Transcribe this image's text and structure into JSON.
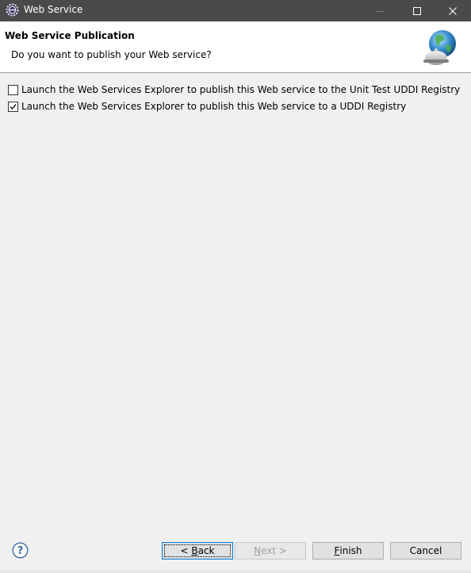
{
  "window": {
    "title": "Web Service",
    "icons": {
      "app": "eclipse-gear-icon",
      "minimize": "minimize-icon",
      "maximize": "maximize-icon",
      "close": "close-icon"
    }
  },
  "banner": {
    "title": "Web Service Publication",
    "description": "Do you want to publish your Web service?",
    "art": "globe-bell-icon"
  },
  "options": [
    {
      "label": "Launch the Web Services Explorer to publish this Web service to the Unit Test UDDI Registry",
      "checked": false
    },
    {
      "label": "Launch the Web Services Explorer to publish this Web service to a UDDI Registry",
      "checked": true
    }
  ],
  "footer": {
    "help_icon": "help-icon",
    "back_prefix": "< ",
    "back_mnemonic": "B",
    "back_rest": "ack",
    "next_mnemonic": "N",
    "next_rest": "ext >",
    "finish_mnemonic": "F",
    "finish_rest": "inish",
    "cancel_label": "Cancel"
  }
}
